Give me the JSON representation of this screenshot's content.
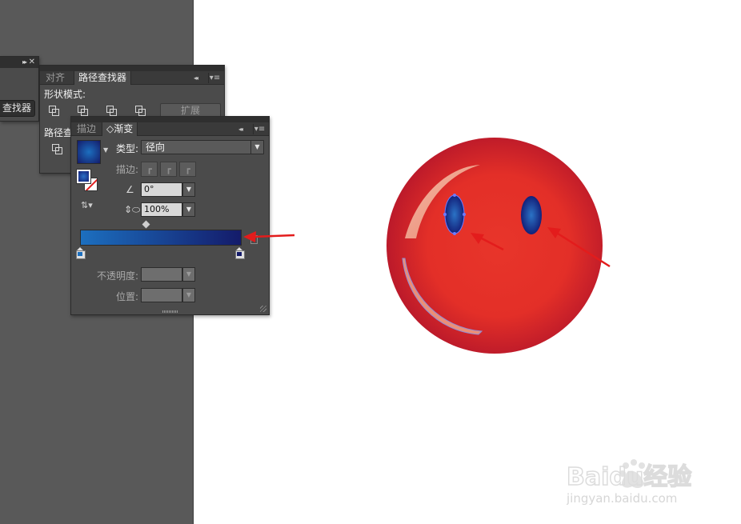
{
  "pathfinder_small": {
    "button_label": "查找器"
  },
  "pathfinder": {
    "tabs": [
      {
        "label": "对齐"
      },
      {
        "label": "路径查找器"
      }
    ],
    "shape_modes_label": "形状模式:",
    "expand_label": "扩展",
    "pathfinders_label": "路径查"
  },
  "gradient": {
    "tabs": [
      {
        "label": "描边"
      },
      {
        "label": "◇渐变"
      }
    ],
    "type_label": "类型:",
    "type_value": "径向",
    "stroke_label": "描边:",
    "angle_value": "0°",
    "aspect_value": "100%",
    "opacity_label": "不透明度:",
    "location_label": "位置:",
    "gradient_colors": [
      "#1c6fbf",
      "#141b6a"
    ]
  },
  "watermark": {
    "line1": "Baidu经验",
    "line2": "jingyan.baidu.com"
  },
  "colors": {
    "face": "#e33027",
    "eye": "#1c3f9c",
    "arrow": "#e31c1c",
    "panel": "#4b4b4b"
  }
}
